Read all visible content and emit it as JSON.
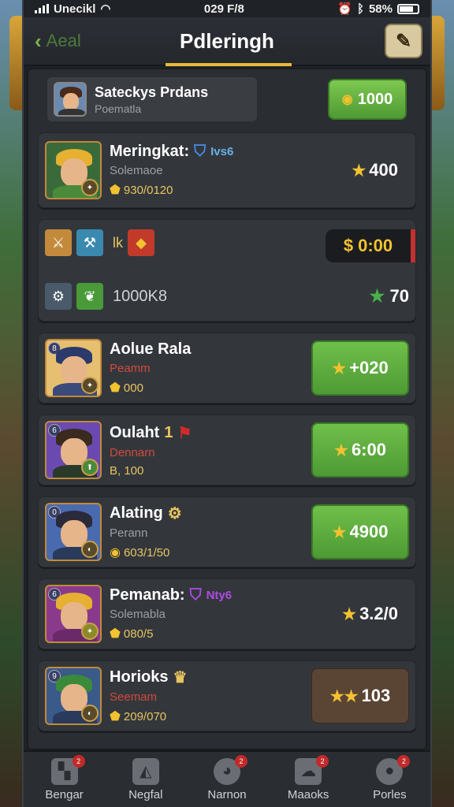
{
  "status": {
    "carrier": "Unecikl",
    "time": "029 F/8",
    "battery": "58%"
  },
  "header": {
    "back_label": "Aeal",
    "title": "Pdleringh",
    "settings_icon": "wrench-icon"
  },
  "profile": {
    "name": "Sateckys Prdans",
    "sub": "Poematla",
    "gold": "1000"
  },
  "cards": [
    {
      "name": "Meringkat:",
      "tag": "Ivs6",
      "sub": "Solemaoe",
      "stat": "930/0120",
      "price": "400",
      "sub_color": "#9aa0a6",
      "hair": "#e6b030",
      "body": "#4a8a3a"
    },
    {
      "name": "Aolue Rala",
      "tag": "",
      "sub": "Peamm",
      "stat": "000",
      "price": "+020",
      "sub_color": "#d24a3a",
      "hair": "#2a3a6a",
      "body": "#3a4a7a"
    },
    {
      "name": "Oulaht",
      "tag": "1",
      "sub": "Dennarn",
      "stat": "B, 100",
      "price": "6:00",
      "sub_color": "#d24a3a",
      "hair": "#3a2a1f",
      "body": "#2a3a2a"
    },
    {
      "name": "Alating",
      "tag": "",
      "sub": "Perann",
      "stat": "603/1/50",
      "price": "4900",
      "sub_color": "#9aa0a6",
      "hair": "#2a2a3a",
      "body": "#2a3a5a"
    },
    {
      "name": "Pemanab:",
      "tag": "Nty6",
      "sub": "Solemabla",
      "stat": "080/5",
      "price": "3.2/0",
      "sub_color": "#9aa0a6",
      "hair": "#e6b030",
      "body": "#6a2a6a"
    },
    {
      "name": "Horioks",
      "tag": "",
      "sub": "Seemam",
      "stat": "209/070",
      "price": "103",
      "sub_color": "#d24a3a",
      "hair": "#3a8a3a",
      "body": "#2a3a5a"
    }
  ],
  "item_card": {
    "label_top": "lk",
    "timer": "0:00",
    "count": "1000K8",
    "reward": "70"
  },
  "nav": [
    {
      "label": "Bengar",
      "badge": "2"
    },
    {
      "label": "Negfal",
      "badge": ""
    },
    {
      "label": "Narnon",
      "badge": "2"
    },
    {
      "label": "Maaoks",
      "badge": "2"
    },
    {
      "label": "Porles",
      "badge": "2"
    }
  ],
  "colors": {
    "accent_gold": "#e8b83a",
    "green": "#6fbf4a",
    "panel": "#33373c"
  }
}
